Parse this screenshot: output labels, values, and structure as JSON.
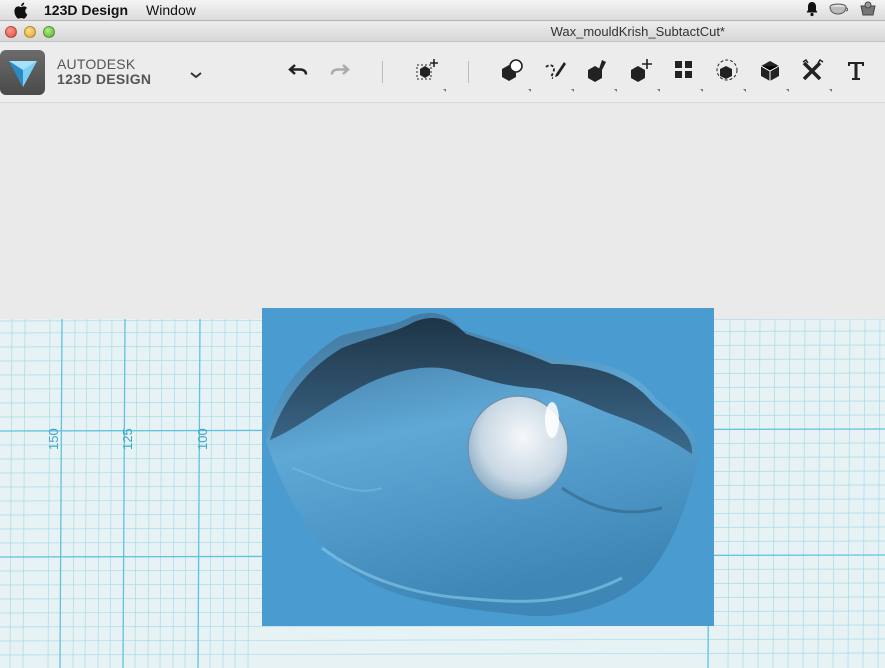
{
  "menubar": {
    "app_name": "123D Design",
    "items": [
      "Window"
    ]
  },
  "window": {
    "document_title": "Wax_mouldKrish_SubtactCut*"
  },
  "brand": {
    "line1": "AUTODESK",
    "line2": "123D DESIGN"
  },
  "toolbar": {
    "tools": [
      {
        "name": "undo-icon"
      },
      {
        "name": "redo-icon"
      },
      {
        "name": "transform-icon"
      },
      {
        "name": "primitives-icon"
      },
      {
        "name": "sketch-icon"
      },
      {
        "name": "construct-icon"
      },
      {
        "name": "modify-icon"
      },
      {
        "name": "pattern-icon"
      },
      {
        "name": "grouping-icon"
      },
      {
        "name": "combine-icon"
      },
      {
        "name": "measure-icon"
      },
      {
        "name": "text-icon"
      }
    ]
  },
  "grid": {
    "labels": [
      "150",
      "125",
      "100"
    ]
  },
  "colors": {
    "grid_line": "#7fd0e8",
    "grid_bg": "#e6f2f4",
    "model_panel": "#4a9bd0",
    "model_dark": "#2b4f6a"
  }
}
